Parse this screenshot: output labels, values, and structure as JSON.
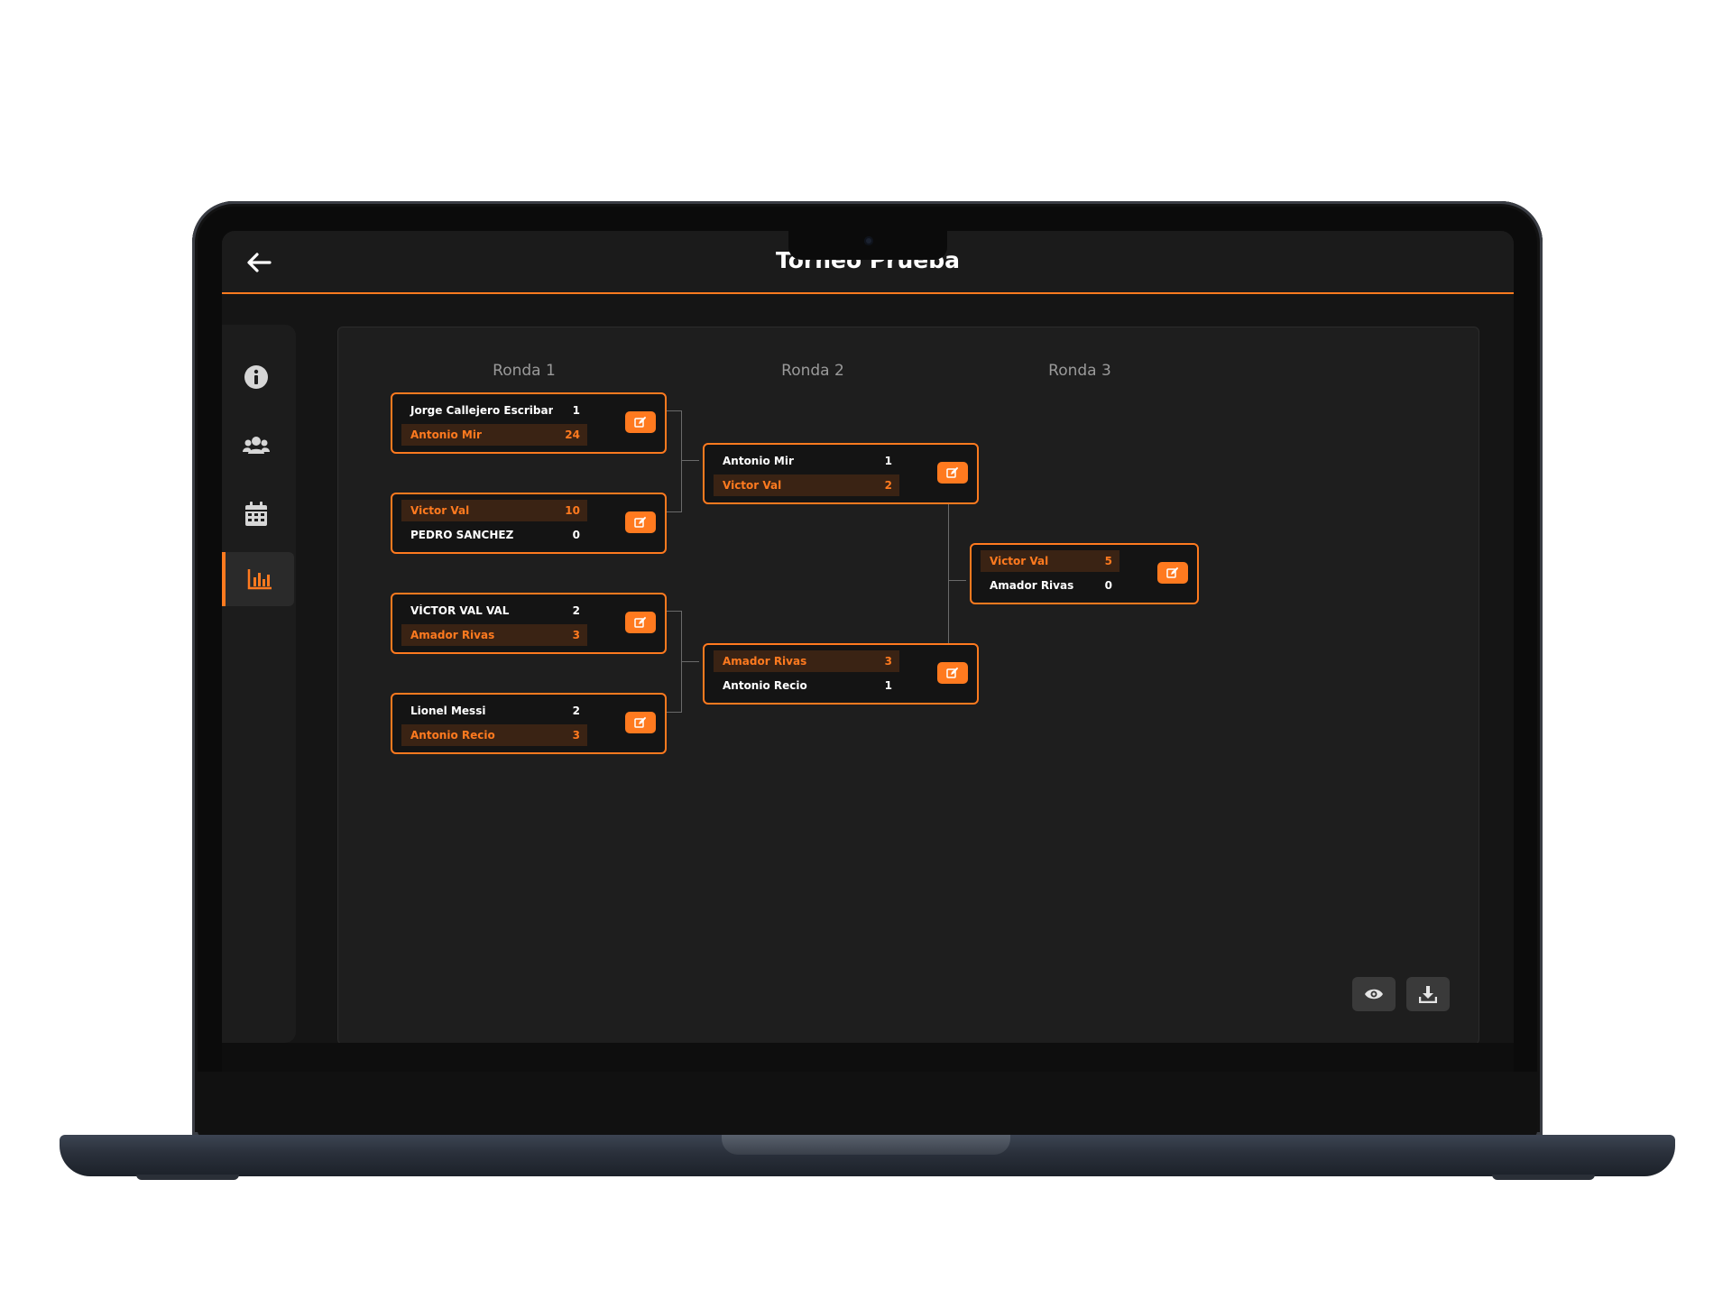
{
  "header": {
    "title": "Torneo Prueba"
  },
  "sidebar": {
    "items": [
      {
        "icon": "info-icon"
      },
      {
        "icon": "users-icon"
      },
      {
        "icon": "calendar-icon"
      },
      {
        "icon": "bar-chart-icon",
        "active": true
      }
    ]
  },
  "bracket": {
    "rounds": [
      {
        "label": "Ronda 1"
      },
      {
        "label": "Ronda 2"
      },
      {
        "label": "Ronda 3"
      }
    ],
    "matches": {
      "r1m1": {
        "p1": "Jorge Callejero Escribano",
        "s1": "1",
        "p2": "Antonio Mir",
        "s2": "24"
      },
      "r1m2": {
        "p1": "Victor Val",
        "s1": "10",
        "p2": "PEDRO SANCHEZ",
        "s2": "0"
      },
      "r1m3": {
        "p1": "VÍCTOR VAL VAL",
        "s1": "2",
        "p2": "Amador Rivas",
        "s2": "3"
      },
      "r1m4": {
        "p1": "Lionel Messi",
        "s1": "2",
        "p2": "Antonio Recio",
        "s2": "3"
      },
      "r2m1": {
        "p1": "Antonio Mir",
        "s1": "1",
        "p2": "Victor Val",
        "s2": "2"
      },
      "r2m2": {
        "p1": "Amador Rivas",
        "s1": "3",
        "p2": "Antonio Recio",
        "s2": "1"
      },
      "r3m1": {
        "p1": "Victor Val",
        "s1": "5",
        "p2": "Amador Rivas",
        "s2": "0"
      }
    }
  },
  "tools": [
    {
      "icon": "eye-icon"
    },
    {
      "icon": "download-icon"
    }
  ],
  "colors": {
    "accent": "#ff7a1f",
    "background": "#151515",
    "panel": "#1e1e1e"
  }
}
